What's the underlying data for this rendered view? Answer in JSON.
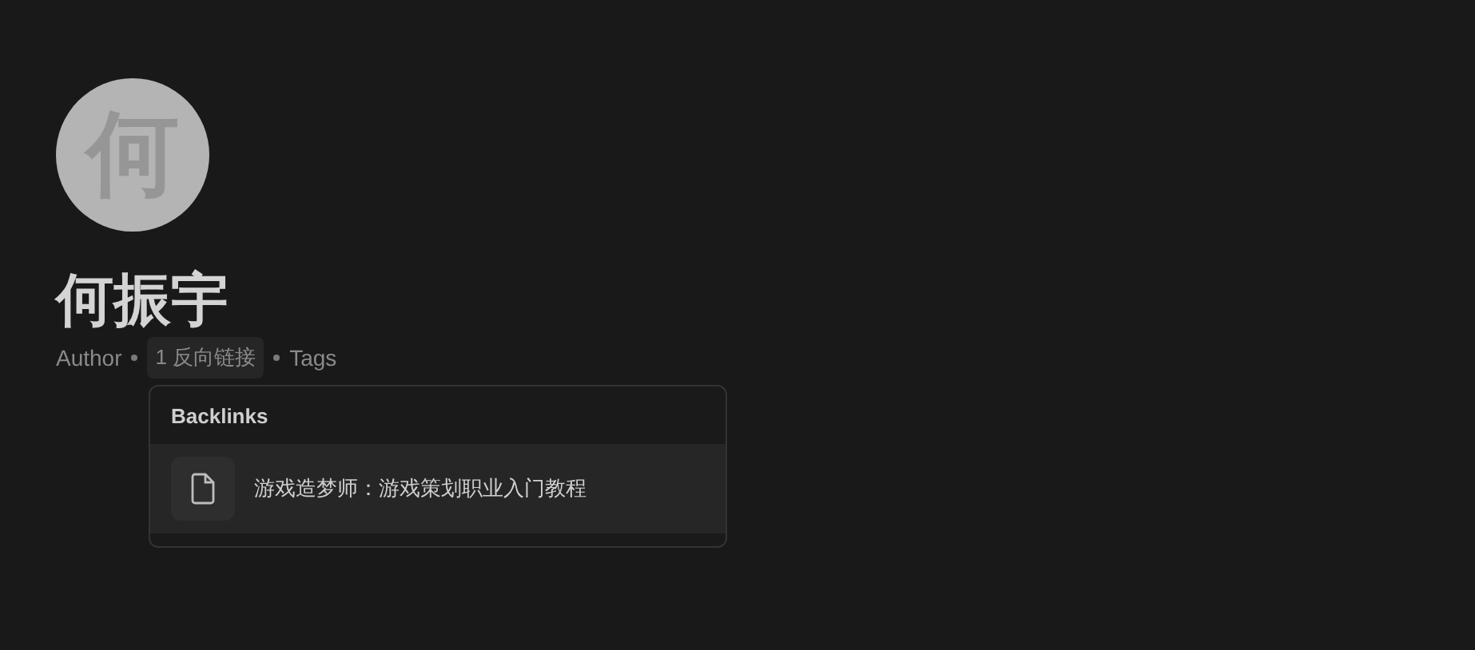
{
  "avatar": {
    "initial": "何"
  },
  "title": "何振宇",
  "meta": [
    {
      "kind": "text",
      "label": "Author"
    },
    {
      "kind": "chip",
      "label": "1 反向链接",
      "active": true
    },
    {
      "kind": "text",
      "label": "Tags"
    }
  ],
  "backlinks_popup": {
    "title": "Backlinks",
    "items": [
      {
        "label": "游戏造梦师：游戏策划职业入门教程",
        "selected": true
      }
    ]
  }
}
